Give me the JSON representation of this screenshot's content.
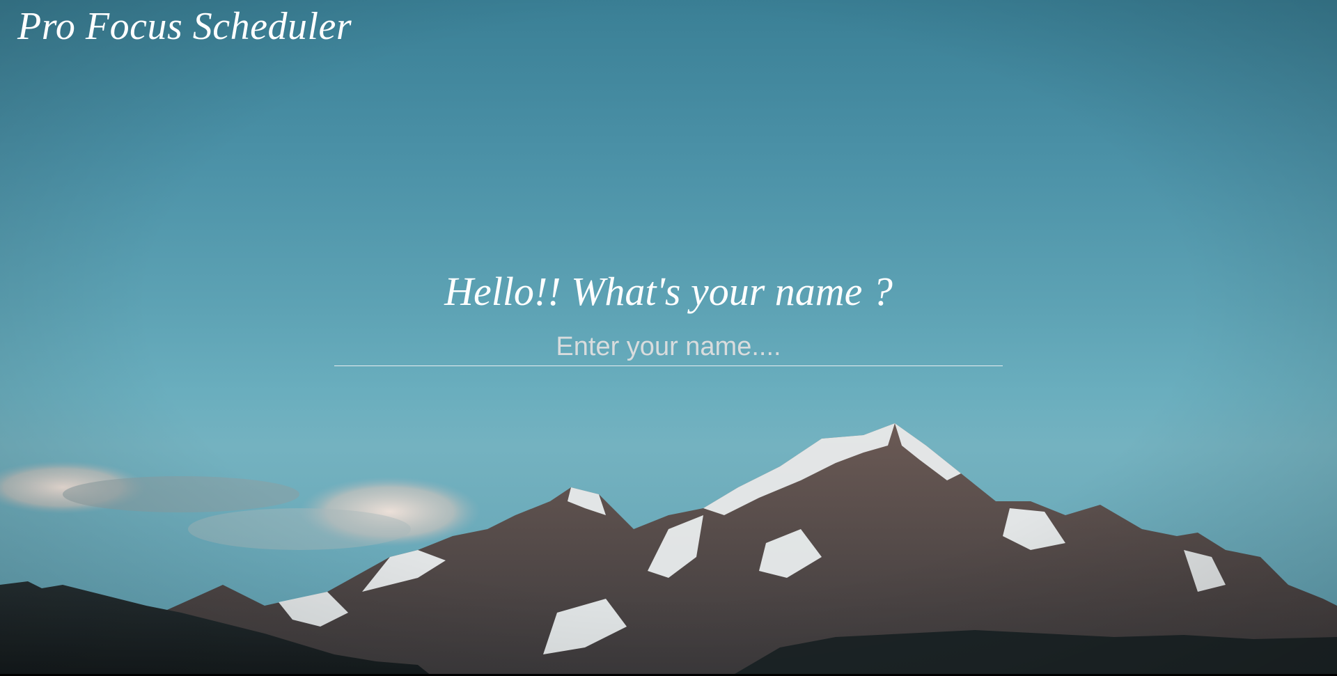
{
  "app": {
    "title": "Pro Focus Scheduler"
  },
  "greeting": {
    "prompt": "Hello!! What's your name ?"
  },
  "name_input": {
    "placeholder": "Enter your name....",
    "value": ""
  },
  "background": {
    "description_icon": "mountain-landscape-image",
    "sky_color": "#5da2b4",
    "accent_text_color": "#ffffff"
  }
}
